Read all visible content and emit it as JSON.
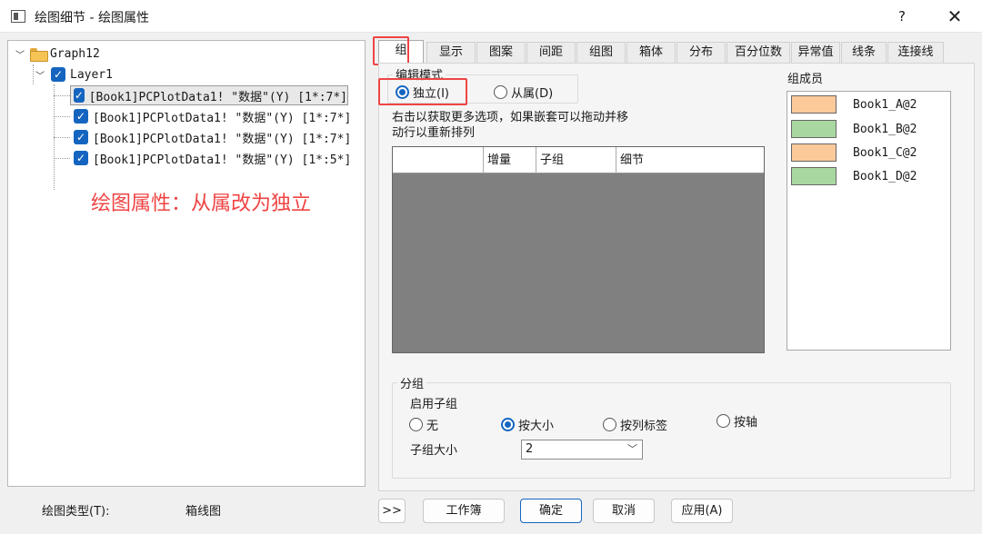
{
  "window": {
    "title": "绘图细节 - 绘图属性",
    "help_label": "?",
    "close_label": "✕"
  },
  "tree": {
    "root_label": "Graph12",
    "layer_label": "Layer1",
    "plots": [
      "[Book1]PCPlotData1! \"数据\"(Y) [1*:7*]",
      "[Book1]PCPlotData1! \"数据\"(Y) [1*:7*]",
      "[Book1]PCPlotData1! \"数据\"(Y) [1*:7*]",
      "[Book1]PCPlotData1! \"数据\"(Y) [1*:5*]"
    ]
  },
  "annotation": {
    "text": "绘图属性：从属改为独立",
    "color": "#ef4444"
  },
  "plot_type": {
    "label": "绘图类型(T):",
    "value": "箱线图"
  },
  "tabs": [
    "组",
    "显示",
    "图案",
    "间距",
    "组图",
    "箱体",
    "分布",
    "百分位数",
    "异常值",
    "线条",
    "连接线"
  ],
  "active_tab": "组",
  "edit_mode": {
    "legend": "编辑模式",
    "independent_label": "独立(I)",
    "dependent_label": "从属(D)",
    "selected": "independent"
  },
  "hint_text": "右击以获取更多选项，如果嵌套可以拖动并移动行以重新排列",
  "grid": {
    "headers": [
      "",
      "增量",
      "子组",
      "细节"
    ]
  },
  "members": {
    "label": "组成员",
    "items": [
      {
        "name": "Book1_A@2",
        "color": "#fcc99a"
      },
      {
        "name": "Book1_B@2",
        "color": "#a8d8a0"
      },
      {
        "name": "Book1_C@2",
        "color": "#fcc99a"
      },
      {
        "name": "Book1_D@2",
        "color": "#a8d8a0"
      }
    ]
  },
  "grouping": {
    "legend": "分组",
    "enable_label": "启用子组",
    "options": [
      {
        "label": "无",
        "selected": false
      },
      {
        "label": "按大小",
        "selected": true
      },
      {
        "label": "按列标签",
        "selected": false
      },
      {
        "label": "按轴",
        "selected": false
      }
    ],
    "subgroup_size_label": "子组大小",
    "subgroup_size_value": "2"
  },
  "buttons": {
    "expand": ">>",
    "workbook": "工作簿",
    "ok": "确定",
    "cancel": "取消",
    "apply": "应用(A)"
  }
}
